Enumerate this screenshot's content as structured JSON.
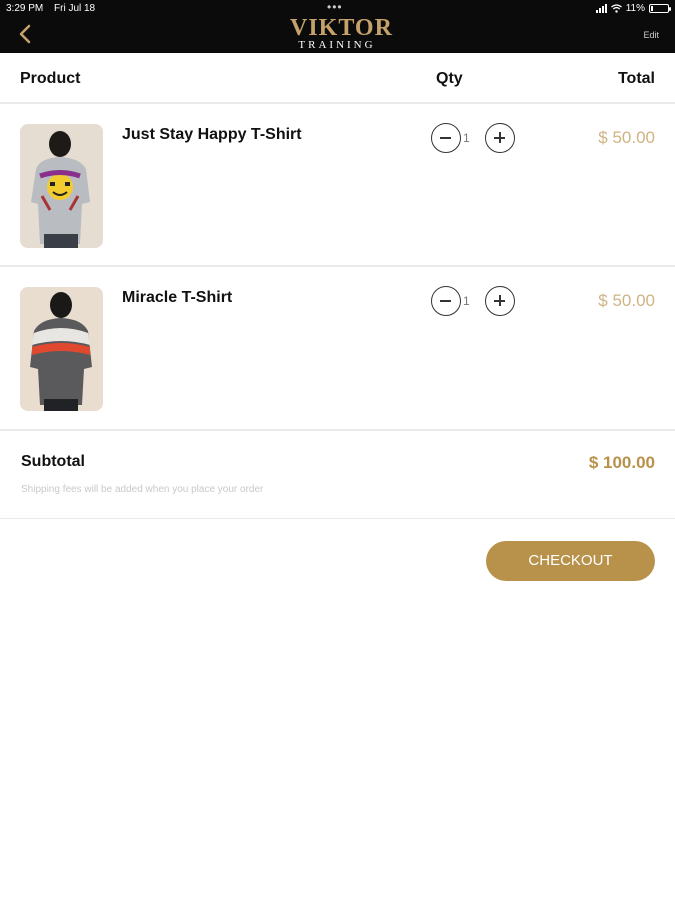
{
  "status_bar": {
    "time": "3:29 PM",
    "date": "Fri Jul 18",
    "dots": "•••",
    "battery": "11%"
  },
  "nav": {
    "logo_main": "VIKTOR",
    "logo_sub": "TRAINING",
    "edit_label": "Edit",
    "back_icon": "chevron-left-icon"
  },
  "table": {
    "headers": {
      "product": "Product",
      "qty": "Qty",
      "total": "Total"
    }
  },
  "items": [
    {
      "name": "Just Stay Happy T-Shirt",
      "qty": "1",
      "price": "$ 50.00"
    },
    {
      "name": "Miracle T-Shirt",
      "qty": "1",
      "price": "$ 50.00"
    }
  ],
  "summary": {
    "subtotal_label": "Subtotal",
    "subtotal_value": "$ 100.00",
    "shipping_note": "Shipping fees will be added when you place your order"
  },
  "actions": {
    "checkout_label": "CHECKOUT"
  },
  "colors": {
    "accent": "#b8924a",
    "price": "#cfb383",
    "topbar": "#0b0b0b"
  }
}
